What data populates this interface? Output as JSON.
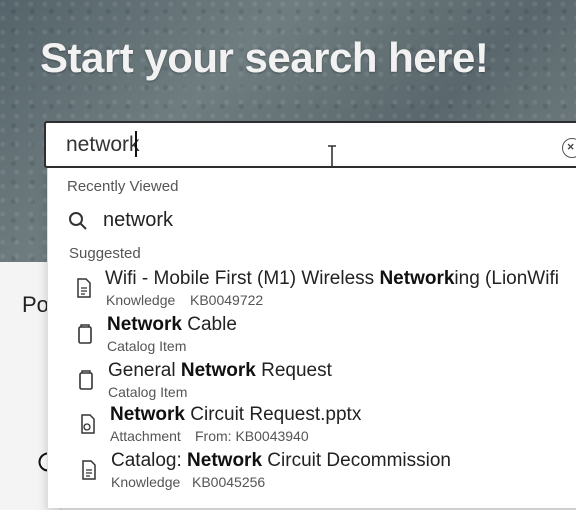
{
  "hero": {
    "title": "Start your search here!"
  },
  "page": {
    "partial_heading": "Po"
  },
  "search": {
    "value": "network",
    "clear_icon": "close-circle-icon"
  },
  "dropdown": {
    "recently_viewed_label": "Recently Viewed",
    "recent": {
      "icon": "search-icon",
      "text": "network"
    },
    "suggested_label": "Suggested",
    "suggestions": [
      {
        "icon": "document-icon",
        "title_parts": [
          {
            "text": "Wifi - Mobile First (M1) Wireless ",
            "bold": false
          },
          {
            "text": "Network",
            "bold": true
          },
          {
            "text": "ing (LionWifi",
            "bold": false
          }
        ],
        "type": "Knowledge",
        "detail": "KB0049722"
      },
      {
        "icon": "catalog-item-icon",
        "title_parts": [
          {
            "text": "Network",
            "bold": true
          },
          {
            "text": " Cable",
            "bold": false
          }
        ],
        "type": "Catalog Item",
        "detail": ""
      },
      {
        "icon": "catalog-item-icon",
        "title_parts": [
          {
            "text": "General ",
            "bold": false
          },
          {
            "text": "Network",
            "bold": true
          },
          {
            "text": " Request",
            "bold": false
          }
        ],
        "type": "Catalog Item",
        "detail": ""
      },
      {
        "icon": "attachment-file-icon",
        "title_parts": [
          {
            "text": "Network",
            "bold": true
          },
          {
            "text": " Circuit Request.pptx",
            "bold": false
          }
        ],
        "type": "Attachment",
        "detail": "From: KB0043940"
      },
      {
        "icon": "document-icon",
        "title_parts": [
          {
            "text": "Catalog: ",
            "bold": false
          },
          {
            "text": "Network",
            "bold": true
          },
          {
            "text": " Circuit Decommission",
            "bold": false
          }
        ],
        "type": "Knowledge",
        "detail": "KB0045256"
      }
    ]
  }
}
